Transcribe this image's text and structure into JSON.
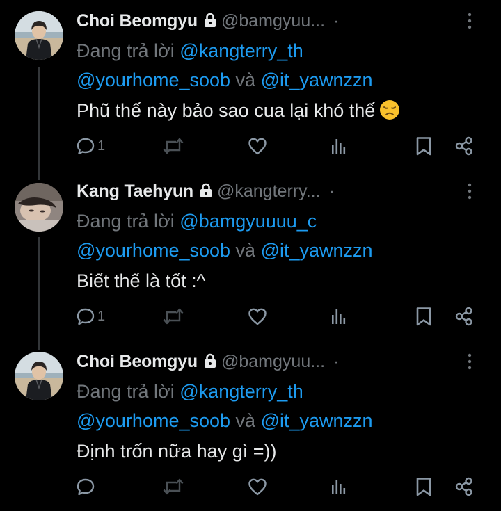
{
  "colors": {
    "background": "#000000",
    "text": "#e7e9ea",
    "muted": "#71767b",
    "link": "#1d9bf0",
    "icon": "#8b98a5"
  },
  "icons": {
    "lock": "lock-icon",
    "more": "more-icon",
    "reply": "reply-icon",
    "retweet": "retweet-icon",
    "like": "heart-icon",
    "views": "views-icon",
    "bookmark": "bookmark-icon",
    "share": "share-icon",
    "emoji": "disappointed-face-emoji"
  },
  "tweets": [
    {
      "name": "Choi Beomgyu",
      "handle": "@bamgyuu...",
      "dot": "·",
      "reply_prefix": "Đang trả lời ",
      "reply_mention_1": "@kangterry_th",
      "reply_mention_2": "@yourhome_soob",
      "reply_and": " và ",
      "reply_mention_3": "@it_yawnzzn",
      "text": "Phũ thế này bảo sao cua lại khó thế",
      "reply_count": "1"
    },
    {
      "name": "Kang Taehyun",
      "handle": "@kangterry...",
      "dot": "·",
      "reply_prefix": "Đang trả lời ",
      "reply_mention_1": "@bamgyuuuu_c",
      "reply_mention_2": "@yourhome_soob",
      "reply_and": " và ",
      "reply_mention_3": "@it_yawnzzn",
      "text": "Biết thế là tốt :^",
      "reply_count": "1"
    },
    {
      "name": "Choi Beomgyu",
      "handle": "@bamgyuu...",
      "dot": "·",
      "reply_prefix": "Đang trả lời ",
      "reply_mention_1": "@kangterry_th",
      "reply_mention_2": "@yourhome_soob",
      "reply_and": " và ",
      "reply_mention_3": "@it_yawnzzn",
      "text": "Định trốn nữa hay gì =))",
      "reply_count": ""
    }
  ]
}
